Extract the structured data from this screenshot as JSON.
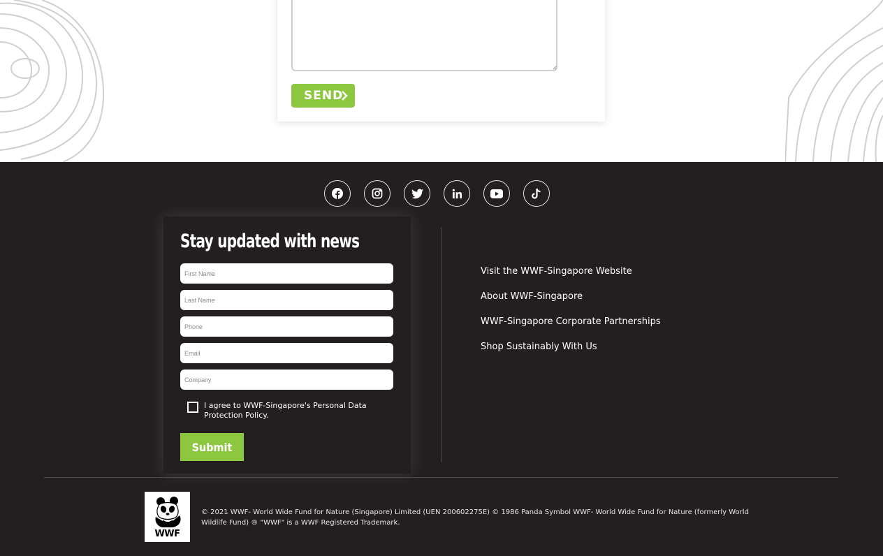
{
  "contact_form": {
    "message_value": "",
    "send_label": "SEND"
  },
  "social_icons": [
    "facebook-icon",
    "instagram-icon",
    "twitter-icon",
    "linkedin-icon",
    "youtube-icon",
    "tiktok-icon"
  ],
  "newsletter": {
    "title": "Stay updated with news",
    "first_name_placeholder": "First Name",
    "last_name_placeholder": "Last Name",
    "phone_placeholder": "Phone",
    "email_placeholder": "Email",
    "company_placeholder": "Company",
    "consent_text": "I agree to WWF-Singapore's Personal Data Protection Policy.",
    "consent_checked": false,
    "submit_label": "Submit"
  },
  "footer_links": [
    "Visit the WWF-Singapore Website",
    "About WWF-Singapore",
    "WWF-Singapore Corporate Partnerships",
    "Shop Sustainably With Us"
  ],
  "logo": {
    "text": "WWF"
  },
  "copyright": "© 2021 WWF- World Wide Fund for Nature (Singapore) Limited (UEN 200602275E) © 1986 Panda Symbol WWF- World Wide Fund for Nature (formerly World Wildlife Fund) ® \"WWF\" is a WWF Registered Trademark.",
  "colors": {
    "accent": "#8dc63f",
    "footer_bg": "#231f20",
    "text_light": "#ffffff"
  }
}
